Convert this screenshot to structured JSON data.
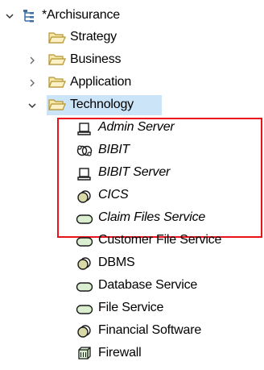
{
  "colors": {
    "selection": "#cce4f7",
    "highlight_box": "#e8131b",
    "folder_fill": "#f7e9a8",
    "folder_stroke": "#b59331",
    "icon_stroke": "#1a1a1a"
  },
  "tree": {
    "root": {
      "label": "*Archisurance",
      "expanded": true,
      "icon": "model-tree-icon"
    },
    "items": [
      {
        "label": "Strategy",
        "icon": "folder-icon",
        "twisty": "none"
      },
      {
        "label": "Business",
        "icon": "folder-icon",
        "twisty": "collapsed"
      },
      {
        "label": "Application",
        "icon": "folder-icon",
        "twisty": "collapsed"
      },
      {
        "label": "Technology",
        "icon": "folder-icon",
        "twisty": "expanded",
        "selected": true
      }
    ],
    "technology_children": [
      {
        "label": "Admin Server",
        "icon": "node-icon",
        "italic": true
      },
      {
        "label": "BIBIT",
        "icon": "technology-collaboration-icon",
        "italic": true
      },
      {
        "label": "BIBIT Server",
        "icon": "node-icon",
        "italic": true
      },
      {
        "label": "CICS",
        "icon": "system-software-icon",
        "italic": true
      },
      {
        "label": "Claim Files Service",
        "icon": "technology-service-icon",
        "italic": true
      },
      {
        "label": "Customer File Service",
        "icon": "technology-service-icon",
        "italic": false
      },
      {
        "label": "DBMS",
        "icon": "system-software-icon",
        "italic": false
      },
      {
        "label": "Database Service",
        "icon": "technology-service-icon",
        "italic": false
      },
      {
        "label": "File Service",
        "icon": "technology-service-icon",
        "italic": false
      },
      {
        "label": "Financial Software",
        "icon": "system-software-icon",
        "italic": false
      },
      {
        "label": "Firewall",
        "icon": "device-icon",
        "italic": false
      }
    ]
  }
}
